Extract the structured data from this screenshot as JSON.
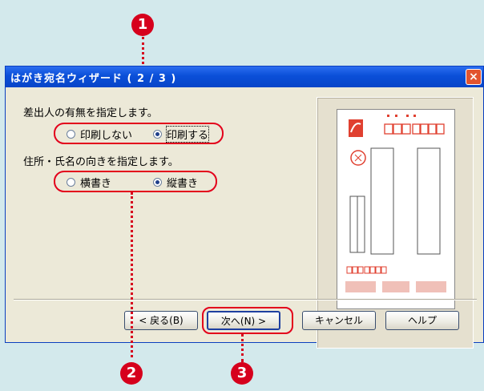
{
  "window": {
    "title": "はがき宛名ウィザード ( 2 / 3 )",
    "close_icon": "×"
  },
  "sections": {
    "sender": {
      "label": "差出人の有無を指定します。",
      "options": [
        {
          "label": "印刷しない",
          "selected": false
        },
        {
          "label": "印刷する",
          "selected": true
        }
      ]
    },
    "orientation": {
      "label": "住所・氏名の向きを指定します。",
      "options": [
        {
          "label": "横書き",
          "selected": false
        },
        {
          "label": "縦書き",
          "selected": true
        }
      ]
    }
  },
  "buttons": {
    "back": "< 戻る(B)",
    "next": "次へ(N) >",
    "cancel": "キャンセル",
    "help": "ヘルプ"
  },
  "callouts": {
    "one": "1",
    "two": "2",
    "three": "3"
  },
  "colors": {
    "callout_red": "#d6001c",
    "titlebar_blue": "#0a4fd8",
    "stamp_red": "#e04030"
  }
}
